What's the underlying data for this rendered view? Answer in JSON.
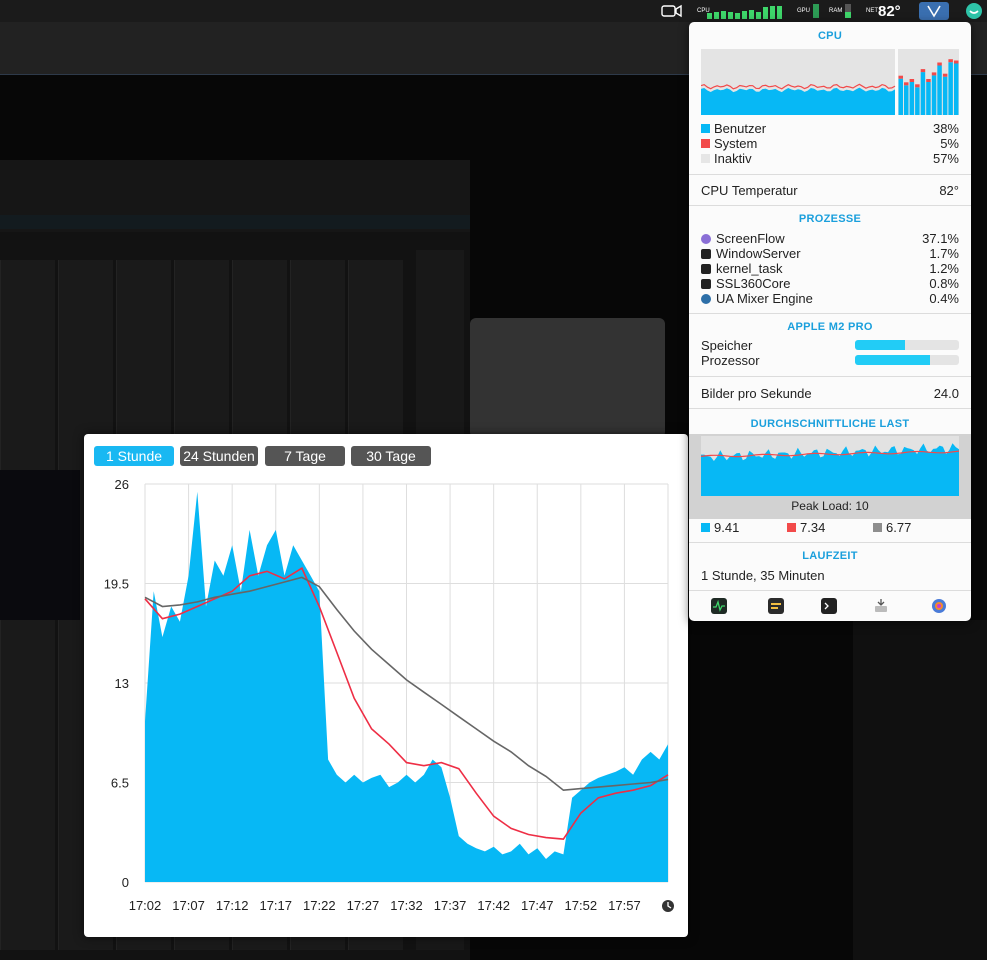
{
  "menubar": {
    "temperature": "82°",
    "cpu_label": "CPU",
    "ram_label": "RAM",
    "gpu_label": "GPU",
    "net_label": "NET",
    "icons": [
      "camera-icon",
      "cpu-meter-icon",
      "memory-meter-icon",
      "ua-logo-icon",
      "istat-icon"
    ]
  },
  "tabs": [
    {
      "label": "1 Stunde",
      "active": true
    },
    {
      "label": "24 Stunden",
      "active": false
    },
    {
      "label": "7 Tage",
      "active": false
    },
    {
      "label": "30 Tage",
      "active": false
    }
  ],
  "chart_data": {
    "type": "area",
    "x_ticks": [
      "17:02",
      "17:07",
      "17:12",
      "17:17",
      "17:22",
      "17:27",
      "17:32",
      "17:37",
      "17:42",
      "17:47",
      "17:52",
      "17:57"
    ],
    "y_ticks": [
      "26",
      "19.5",
      "13",
      "6.5",
      "0"
    ],
    "ylim": [
      0,
      26
    ],
    "grid": true,
    "series": [
      {
        "kind": "area",
        "color": "#07b8f5",
        "x": [
          "17:02",
          "17:03",
          "17:04",
          "17:05",
          "17:06",
          "17:07",
          "17:08",
          "17:09",
          "17:10",
          "17:11",
          "17:12",
          "17:13",
          "17:14",
          "17:15",
          "17:16",
          "17:17",
          "17:18",
          "17:19",
          "17:20",
          "17:21",
          "17:22",
          "17:23",
          "17:24",
          "17:25",
          "17:26",
          "17:27",
          "17:28",
          "17:29",
          "17:30",
          "17:31",
          "17:32",
          "17:33",
          "17:34",
          "17:35",
          "17:36",
          "17:37",
          "17:38",
          "17:39",
          "17:40",
          "17:41",
          "17:42",
          "17:43",
          "17:44",
          "17:45",
          "17:46",
          "17:47",
          "17:48",
          "17:49",
          "17:50",
          "17:51",
          "17:52",
          "17:53",
          "17:54",
          "17:55",
          "17:56",
          "17:57",
          "17:58",
          "17:59",
          "18:00",
          "18:01",
          "18:02"
        ],
        "values": [
          10.5,
          19,
          16,
          18,
          17,
          20,
          25.5,
          18,
          21,
          20,
          22,
          19,
          23,
          20,
          22,
          23,
          20,
          22,
          21,
          20,
          19,
          8,
          7,
          6.5,
          7,
          6.5,
          6.8,
          7,
          6.2,
          6.5,
          7,
          6.5,
          7,
          8,
          7.5,
          5.5,
          3,
          2.5,
          2.2,
          2,
          2.3,
          1.8,
          2,
          2.5,
          1.8,
          2.2,
          1.5,
          2,
          1.8,
          5.5,
          6,
          6.5,
          6.8,
          7,
          7.2,
          7.5,
          7,
          8,
          8.5,
          8,
          9
        ]
      },
      {
        "kind": "line",
        "color": "#ee2e45",
        "x": [
          "17:02",
          "17:04",
          "17:06",
          "17:08",
          "17:10",
          "17:12",
          "17:14",
          "17:16",
          "17:18",
          "17:20",
          "17:22",
          "17:24",
          "17:26",
          "17:28",
          "17:30",
          "17:32",
          "17:34",
          "17:36",
          "17:38",
          "17:40",
          "17:42",
          "17:44",
          "17:46",
          "17:48",
          "17:50",
          "17:52",
          "17:54",
          "17:56",
          "17:58",
          "18:00",
          "18:02"
        ],
        "values": [
          18.5,
          17.2,
          17.5,
          18,
          18.5,
          19,
          20,
          20.3,
          19.8,
          20.5,
          18,
          15,
          12,
          10,
          9,
          7.8,
          7.6,
          7.8,
          7.4,
          5.8,
          4.3,
          3.5,
          3.1,
          2.9,
          2.8,
          4.5,
          5.5,
          5.8,
          6,
          6.3,
          7
        ]
      },
      {
        "kind": "line",
        "color": "#666666",
        "x": [
          "17:02",
          "17:04",
          "17:06",
          "17:08",
          "17:10",
          "17:12",
          "17:14",
          "17:16",
          "17:18",
          "17:20",
          "17:22",
          "17:24",
          "17:26",
          "17:28",
          "17:30",
          "17:32",
          "17:34",
          "17:36",
          "17:38",
          "17:40",
          "17:42",
          "17:44",
          "17:46",
          "17:48",
          "17:50",
          "17:52",
          "17:54",
          "17:56",
          "17:58",
          "18:00",
          "18:02"
        ],
        "values": [
          18.6,
          18,
          18.1,
          18.3,
          18.6,
          18.8,
          19,
          19.3,
          19.6,
          19.9,
          19.3,
          17.8,
          16.4,
          15.2,
          14.2,
          13.2,
          12.4,
          11.6,
          10.8,
          10,
          9.2,
          8.5,
          7.6,
          6.9,
          6,
          6.1,
          6.2,
          6.3,
          6.4,
          6.5,
          6.7
        ]
      }
    ]
  },
  "panel": {
    "cpu": {
      "title": "CPU",
      "legend": [
        {
          "name": "Benutzer",
          "value": "38%",
          "color": "#07b8f5"
        },
        {
          "name": "System",
          "value": "5%",
          "color": "#f24a4a"
        },
        {
          "name": "Inaktiv",
          "value": "57%",
          "color": "#e6e6e6"
        }
      ],
      "core_levels": [
        0.55,
        0.45,
        0.5,
        0.42,
        0.65,
        0.5,
        0.6,
        0.75,
        0.58,
        0.8,
        0.78
      ]
    },
    "cpu_temp": {
      "label": "CPU Temperatur",
      "value": "82°"
    },
    "processes": {
      "title": "PROZESSE",
      "items": [
        {
          "name": "ScreenFlow",
          "value": "37.1%",
          "icon": "screenflow-icon"
        },
        {
          "name": "WindowServer",
          "value": "1.7%",
          "icon": "windowserver-icon"
        },
        {
          "name": "kernel_task",
          "value": "1.2%",
          "icon": "terminal-icon"
        },
        {
          "name": "SSL360Core",
          "value": "0.8%",
          "icon": "ssl-icon"
        },
        {
          "name": "UA Mixer Engine",
          "value": "0.4%",
          "icon": "ua-mixer-icon"
        }
      ]
    },
    "chip": {
      "title": "APPLE M2 PRO",
      "rows": [
        {
          "label": "Speicher",
          "level": 0.48
        },
        {
          "label": "Prozessor",
          "level": 0.72
        }
      ]
    },
    "fps": {
      "label": "Bilder pro Sekunde",
      "value": "24.0"
    },
    "load": {
      "title": "DURCHSCHNITTLICHE LAST",
      "peak": "Peak Load: 10",
      "values": [
        {
          "value": "9.41",
          "color": "#07b8f5"
        },
        {
          "value": "7.34",
          "color": "#f24a4a"
        },
        {
          "value": "6.77",
          "color": "#8e8e8e"
        }
      ]
    },
    "uptime": {
      "title": "LAUFZEIT",
      "value": "1 Stunde, 35 Minuten"
    },
    "footer_icons": [
      "activity-monitor-icon",
      "console-icon",
      "terminal-icon",
      "disk-utility-icon",
      "system-info-icon"
    ]
  }
}
